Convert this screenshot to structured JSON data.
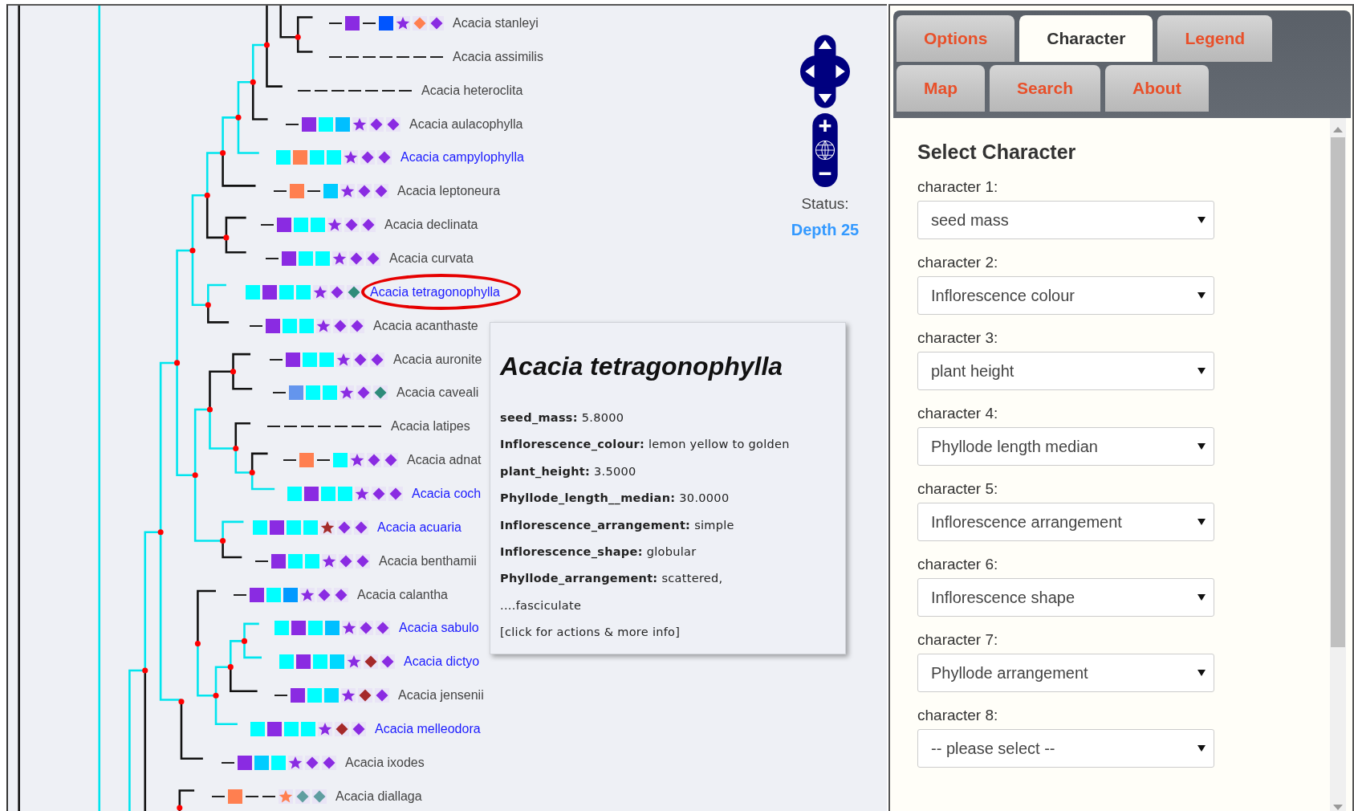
{
  "leaves": [
    {
      "name": "Acacia stanleyi",
      "linked": false,
      "selected": false,
      "markers": [
        {
          "kind": "dash"
        },
        {
          "kind": "square",
          "color": "#8a2be2"
        },
        {
          "kind": "dash"
        },
        {
          "kind": "square",
          "color": "#0055ff"
        },
        {
          "kind": "star",
          "color": "#8a2be2"
        },
        {
          "kind": "diamond",
          "color": "#ff7f50"
        },
        {
          "kind": "diamond",
          "color": "#8a2be2"
        }
      ]
    },
    {
      "name": "Acacia assimilis",
      "linked": false,
      "selected": false,
      "markers": [
        {
          "kind": "dash"
        },
        {
          "kind": "dash"
        },
        {
          "kind": "dash"
        },
        {
          "kind": "dash"
        },
        {
          "kind": "dash"
        },
        {
          "kind": "dash"
        },
        {
          "kind": "dash"
        }
      ]
    },
    {
      "name": "Acacia heteroclita",
      "linked": false,
      "selected": false,
      "markers": [
        {
          "kind": "dash"
        },
        {
          "kind": "dash"
        },
        {
          "kind": "dash"
        },
        {
          "kind": "dash"
        },
        {
          "kind": "dash"
        },
        {
          "kind": "dash"
        },
        {
          "kind": "dash"
        }
      ]
    },
    {
      "name": "Acacia aulacophylla",
      "linked": false,
      "selected": false,
      "markers": [
        {
          "kind": "dash"
        },
        {
          "kind": "square",
          "color": "#8a2be2"
        },
        {
          "kind": "square",
          "color": "#00ffff"
        },
        {
          "kind": "square",
          "color": "#00bfff"
        },
        {
          "kind": "star",
          "color": "#8a2be2"
        },
        {
          "kind": "diamond",
          "color": "#8a2be2"
        },
        {
          "kind": "diamond",
          "color": "#8a2be2"
        }
      ]
    },
    {
      "name": "Acacia campylophylla",
      "linked": true,
      "selected": false,
      "markers": [
        {
          "kind": "square",
          "color": "#00ffff"
        },
        {
          "kind": "square",
          "color": "#ff7f50"
        },
        {
          "kind": "square",
          "color": "#00ffff"
        },
        {
          "kind": "square",
          "color": "#00ffff"
        },
        {
          "kind": "star",
          "color": "#8a2be2"
        },
        {
          "kind": "diamond",
          "color": "#8a2be2"
        },
        {
          "kind": "diamond",
          "color": "#8a2be2"
        }
      ]
    },
    {
      "name": "Acacia leptoneura",
      "linked": false,
      "selected": false,
      "markers": [
        {
          "kind": "dash"
        },
        {
          "kind": "square",
          "color": "#ff7f50"
        },
        {
          "kind": "dash"
        },
        {
          "kind": "square",
          "color": "#00ccff"
        },
        {
          "kind": "star",
          "color": "#8a2be2"
        },
        {
          "kind": "diamond",
          "color": "#8a2be2"
        },
        {
          "kind": "diamond",
          "color": "#8a2be2"
        }
      ]
    },
    {
      "name": "Acacia declinata",
      "linked": false,
      "selected": false,
      "markers": [
        {
          "kind": "dash"
        },
        {
          "kind": "square",
          "color": "#8a2be2"
        },
        {
          "kind": "square",
          "color": "#00ffff"
        },
        {
          "kind": "square",
          "color": "#00ffff"
        },
        {
          "kind": "star",
          "color": "#8a2be2"
        },
        {
          "kind": "diamond",
          "color": "#8a2be2"
        },
        {
          "kind": "diamond",
          "color": "#8a2be2"
        }
      ]
    },
    {
      "name": "Acacia curvata",
      "linked": false,
      "selected": false,
      "markers": [
        {
          "kind": "dash"
        },
        {
          "kind": "square",
          "color": "#8a2be2"
        },
        {
          "kind": "square",
          "color": "#00ffff"
        },
        {
          "kind": "square",
          "color": "#00ffff"
        },
        {
          "kind": "star",
          "color": "#8a2be2"
        },
        {
          "kind": "diamond",
          "color": "#8a2be2"
        },
        {
          "kind": "diamond",
          "color": "#8a2be2"
        }
      ]
    },
    {
      "name": "Acacia tetragonophylla",
      "linked": true,
      "selected": true,
      "markers": [
        {
          "kind": "square",
          "color": "#00ffff"
        },
        {
          "kind": "square",
          "color": "#8a2be2"
        },
        {
          "kind": "square",
          "color": "#00ffff"
        },
        {
          "kind": "square",
          "color": "#00ffff"
        },
        {
          "kind": "star",
          "color": "#8a2be2"
        },
        {
          "kind": "diamond",
          "color": "#8a2be2"
        },
        {
          "kind": "diamond",
          "color": "#2e8b7a"
        }
      ]
    },
    {
      "name": "Acacia acanthaste",
      "linked": false,
      "selected": false,
      "markers": [
        {
          "kind": "dash"
        },
        {
          "kind": "square",
          "color": "#8a2be2"
        },
        {
          "kind": "square",
          "color": "#00ffff"
        },
        {
          "kind": "square",
          "color": "#00ffff"
        },
        {
          "kind": "star",
          "color": "#8a2be2"
        },
        {
          "kind": "diamond",
          "color": "#8a2be2"
        },
        {
          "kind": "diamond",
          "color": "#8a2be2"
        }
      ]
    },
    {
      "name": "Acacia auronite",
      "linked": false,
      "selected": false,
      "markers": [
        {
          "kind": "dash"
        },
        {
          "kind": "square",
          "color": "#8a2be2"
        },
        {
          "kind": "square",
          "color": "#00ffff"
        },
        {
          "kind": "square",
          "color": "#00ffff"
        },
        {
          "kind": "star",
          "color": "#8a2be2"
        },
        {
          "kind": "diamond",
          "color": "#8a2be2"
        },
        {
          "kind": "diamond",
          "color": "#8a2be2"
        }
      ]
    },
    {
      "name": "Acacia caveali",
      "linked": false,
      "selected": false,
      "markers": [
        {
          "kind": "dash"
        },
        {
          "kind": "square",
          "color": "#6495ed"
        },
        {
          "kind": "square",
          "color": "#00ffff"
        },
        {
          "kind": "square",
          "color": "#00ffff"
        },
        {
          "kind": "star",
          "color": "#8a2be2"
        },
        {
          "kind": "diamond",
          "color": "#8a2be2"
        },
        {
          "kind": "diamond",
          "color": "#2e8b7a"
        }
      ]
    },
    {
      "name": "Acacia latipes",
      "linked": false,
      "selected": false,
      "markers": [
        {
          "kind": "dash"
        },
        {
          "kind": "dash"
        },
        {
          "kind": "dash"
        },
        {
          "kind": "dash"
        },
        {
          "kind": "dash"
        },
        {
          "kind": "dash"
        },
        {
          "kind": "dash"
        }
      ]
    },
    {
      "name": "Acacia adnat",
      "linked": false,
      "selected": false,
      "markers": [
        {
          "kind": "dash"
        },
        {
          "kind": "square",
          "color": "#ff7f50"
        },
        {
          "kind": "dash"
        },
        {
          "kind": "square",
          "color": "#00ffff"
        },
        {
          "kind": "star",
          "color": "#8a2be2"
        },
        {
          "kind": "diamond",
          "color": "#8a2be2"
        },
        {
          "kind": "diamond",
          "color": "#8a2be2"
        }
      ]
    },
    {
      "name": "Acacia coch",
      "linked": true,
      "selected": false,
      "markers": [
        {
          "kind": "square",
          "color": "#00ffff"
        },
        {
          "kind": "square",
          "color": "#8a2be2"
        },
        {
          "kind": "square",
          "color": "#00ffff"
        },
        {
          "kind": "square",
          "color": "#00ffff"
        },
        {
          "kind": "star",
          "color": "#8a2be2"
        },
        {
          "kind": "diamond",
          "color": "#8a2be2"
        },
        {
          "kind": "diamond",
          "color": "#8a2be2"
        }
      ]
    },
    {
      "name": "Acacia acuaria",
      "linked": true,
      "selected": false,
      "markers": [
        {
          "kind": "square",
          "color": "#00ffff"
        },
        {
          "kind": "square",
          "color": "#8a2be2"
        },
        {
          "kind": "square",
          "color": "#00ffff"
        },
        {
          "kind": "square",
          "color": "#00ffff"
        },
        {
          "kind": "star",
          "color": "#a52a2a"
        },
        {
          "kind": "diamond",
          "color": "#8a2be2"
        },
        {
          "kind": "diamond",
          "color": "#8a2be2"
        }
      ]
    },
    {
      "name": "Acacia benthamii",
      "linked": false,
      "selected": false,
      "markers": [
        {
          "kind": "dash"
        },
        {
          "kind": "square",
          "color": "#8a2be2"
        },
        {
          "kind": "square",
          "color": "#00ffff"
        },
        {
          "kind": "square",
          "color": "#00ffff"
        },
        {
          "kind": "star",
          "color": "#8a2be2"
        },
        {
          "kind": "diamond",
          "color": "#8a2be2"
        },
        {
          "kind": "diamond",
          "color": "#8a2be2"
        }
      ]
    },
    {
      "name": "Acacia calantha",
      "linked": false,
      "selected": false,
      "markers": [
        {
          "kind": "dash"
        },
        {
          "kind": "square",
          "color": "#8a2be2"
        },
        {
          "kind": "square",
          "color": "#00ffff"
        },
        {
          "kind": "square",
          "color": "#0099ff"
        },
        {
          "kind": "star",
          "color": "#8a2be2"
        },
        {
          "kind": "diamond",
          "color": "#8a2be2"
        },
        {
          "kind": "diamond",
          "color": "#8a2be2"
        }
      ]
    },
    {
      "name": "Acacia sabulo",
      "linked": true,
      "selected": false,
      "markers": [
        {
          "kind": "square",
          "color": "#00ffff"
        },
        {
          "kind": "square",
          "color": "#8a2be2"
        },
        {
          "kind": "square",
          "color": "#00ffff"
        },
        {
          "kind": "square",
          "color": "#00bfff"
        },
        {
          "kind": "star",
          "color": "#8a2be2"
        },
        {
          "kind": "diamond",
          "color": "#8a2be2"
        },
        {
          "kind": "diamond",
          "color": "#8a2be2"
        }
      ]
    },
    {
      "name": "Acacia dictyo",
      "linked": true,
      "selected": false,
      "markers": [
        {
          "kind": "square",
          "color": "#00ffff"
        },
        {
          "kind": "square",
          "color": "#8a2be2"
        },
        {
          "kind": "square",
          "color": "#00ffff"
        },
        {
          "kind": "square",
          "color": "#00d8ff"
        },
        {
          "kind": "star",
          "color": "#8a2be2"
        },
        {
          "kind": "diamond",
          "color": "#a52a2a"
        },
        {
          "kind": "diamond",
          "color": "#8a2be2"
        }
      ]
    },
    {
      "name": "Acacia jensenii",
      "linked": false,
      "selected": false,
      "markers": [
        {
          "kind": "dash"
        },
        {
          "kind": "square",
          "color": "#8a2be2"
        },
        {
          "kind": "square",
          "color": "#00ffff"
        },
        {
          "kind": "square",
          "color": "#00e0ff"
        },
        {
          "kind": "star",
          "color": "#8a2be2"
        },
        {
          "kind": "diamond",
          "color": "#a52a2a"
        },
        {
          "kind": "diamond",
          "color": "#8a2be2"
        }
      ]
    },
    {
      "name": "Acacia melleodora",
      "linked": true,
      "selected": false,
      "markers": [
        {
          "kind": "square",
          "color": "#00ffff"
        },
        {
          "kind": "square",
          "color": "#8a2be2"
        },
        {
          "kind": "square",
          "color": "#00ffff"
        },
        {
          "kind": "square",
          "color": "#00ffff"
        },
        {
          "kind": "star",
          "color": "#8a2be2"
        },
        {
          "kind": "diamond",
          "color": "#a52a2a"
        },
        {
          "kind": "diamond",
          "color": "#8a2be2"
        }
      ]
    },
    {
      "name": "Acacia ixodes",
      "linked": false,
      "selected": false,
      "markers": [
        {
          "kind": "dash"
        },
        {
          "kind": "square",
          "color": "#8a2be2"
        },
        {
          "kind": "square",
          "color": "#00ccff"
        },
        {
          "kind": "square",
          "color": "#00ffff"
        },
        {
          "kind": "star",
          "color": "#8a2be2"
        },
        {
          "kind": "diamond",
          "color": "#8a2be2"
        },
        {
          "kind": "diamond",
          "color": "#8a2be2"
        }
      ]
    },
    {
      "name": "Acacia diallaga",
      "linked": false,
      "selected": false,
      "markers": [
        {
          "kind": "dash"
        },
        {
          "kind": "square",
          "color": "#ff7f50"
        },
        {
          "kind": "dash"
        },
        {
          "kind": "dash"
        },
        {
          "kind": "star",
          "color": "#ff7f50"
        },
        {
          "kind": "diamond",
          "color": "#5f9ea0"
        },
        {
          "kind": "diamond",
          "color": "#5f9ea0"
        }
      ]
    }
  ],
  "status": {
    "label": "Status:",
    "value": "Depth 25"
  },
  "tooltip": {
    "title": "Acacia tetragonophylla",
    "lines": [
      {
        "label": "seed_mass:",
        "value": "5.8000"
      },
      {
        "label": "Inflorescence_colour:",
        "value": "lemon yellow to golden"
      },
      {
        "label": "plant_height:",
        "value": "3.5000"
      },
      {
        "label": "Phyllode_length__median:",
        "value": "30.0000"
      },
      {
        "label": "Inflorescence_arrangement:",
        "value": "simple"
      },
      {
        "label": "Inflorescence_shape:",
        "value": "globular"
      },
      {
        "label": "Phyllode_arrangement:",
        "value": "scattered,"
      }
    ],
    "continuation": "....fasciculate",
    "hint": "[click for actions & more info]"
  },
  "tabs": [
    {
      "label": "Options",
      "selected": false
    },
    {
      "label": "Character",
      "selected": true
    },
    {
      "label": "Legend",
      "selected": false
    },
    {
      "label": "Map",
      "selected": false
    },
    {
      "label": "Search",
      "selected": false
    },
    {
      "label": "About",
      "selected": false
    }
  ],
  "panel": {
    "heading": "Select Character",
    "characters": [
      {
        "label": "character 1:",
        "value": "seed mass"
      },
      {
        "label": "character 2:",
        "value": "Inflorescence colour"
      },
      {
        "label": "character 3:",
        "value": "plant height"
      },
      {
        "label": "character 4:",
        "value": "Phyllode length median"
      },
      {
        "label": "character 5:",
        "value": "Inflorescence arrangement"
      },
      {
        "label": "character 6:",
        "value": "Inflorescence shape"
      },
      {
        "label": "character 7:",
        "value": "Phyllode arrangement"
      },
      {
        "label": "character 8:",
        "value": "-- please select --"
      }
    ]
  }
}
